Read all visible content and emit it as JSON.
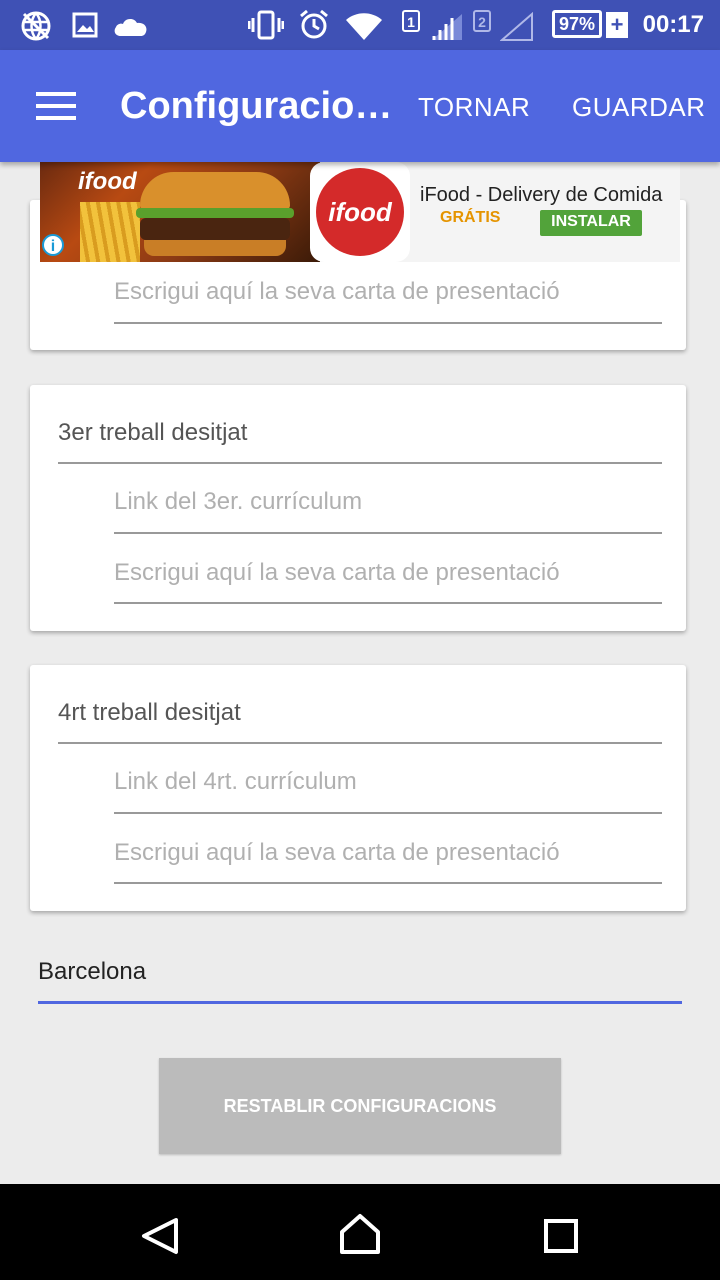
{
  "status_bar": {
    "time": "00:17",
    "battery": "97%",
    "battery_plus": "+",
    "sim1": "1",
    "sim2": "2",
    "icons": [
      "globe-icon",
      "image-icon",
      "cloud-icon",
      "vibrate-icon",
      "alarm-icon",
      "wifi-icon",
      "signal-icon",
      "signal-empty-icon",
      "battery-icon"
    ]
  },
  "app_bar": {
    "title": "Configuracio…",
    "back_label": "TORNAR",
    "save_label": "GUARDAR",
    "color": "#5067e0"
  },
  "ad": {
    "logo_text": "ifood",
    "title": "iFood - Delivery de Comida",
    "price": "GRÁTIS",
    "install_label": "INSTALAR"
  },
  "cards": [
    {
      "title": "",
      "fields": [
        {
          "placeholder": "Escrigui aquí la seva carta de presentació"
        }
      ]
    },
    {
      "title": "3er treball desitjat",
      "fields": [
        {
          "placeholder": "Link del 3er. currículum"
        },
        {
          "placeholder": "Escrigui aquí la seva carta de presentació"
        }
      ]
    },
    {
      "title": "4rt treball desitjat",
      "fields": [
        {
          "placeholder": "Link del 4rt. currículum"
        },
        {
          "placeholder": "Escrigui aquí la seva carta de presentació"
        }
      ]
    }
  ],
  "city": {
    "value": "Barcelona"
  },
  "reset_label": "RESTABLIR CONFIGURACIONS",
  "nav": [
    "back-icon",
    "home-icon",
    "recents-icon"
  ]
}
